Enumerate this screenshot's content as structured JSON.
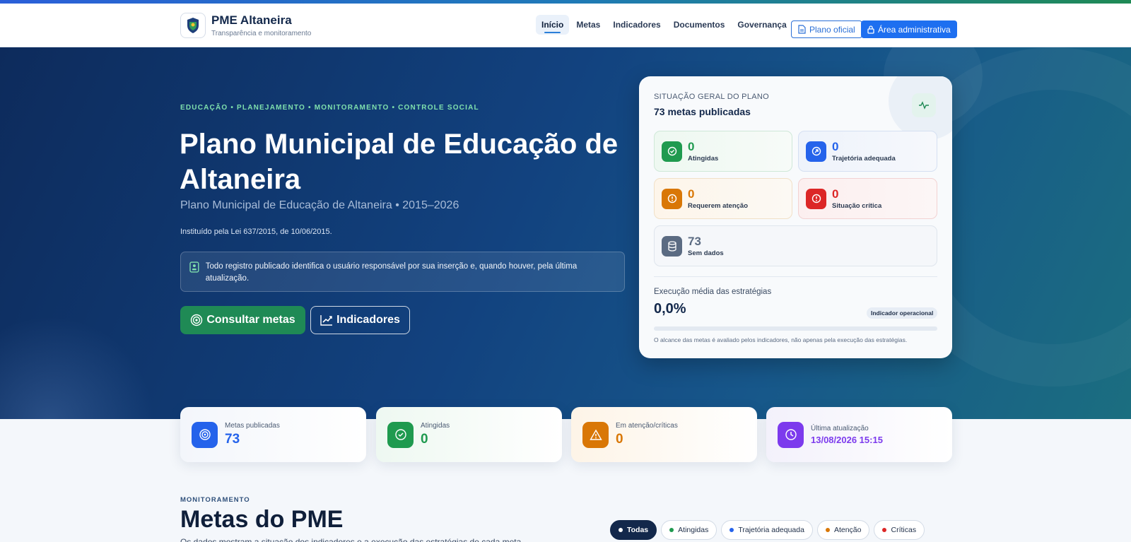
{
  "header": {
    "brand_name": "PME Altaneira",
    "brand_sub": "Transparência e monitoramento",
    "nav": [
      "Início",
      "Metas",
      "Indicadores",
      "Documentos",
      "Governança"
    ],
    "plan_button": "Plano oficial",
    "admin_button": "Área administrativa"
  },
  "hero": {
    "eyebrow": "EDUCAÇÃO • PLANEJAMENTO • MONITORAMENTO • CONTROLE SOCIAL",
    "title": "Plano Municipal de Educação de Altaneira",
    "subtitle": "Plano Municipal de Educação de Altaneira • 2015–2026",
    "law": "Instituído pela Lei 637/2015, de 10/06/2015.",
    "notice": "Todo registro publicado identifica o usuário responsável por sua inserção e, quando houver, pela última atualização.",
    "cta_metas": "Consultar metas",
    "cta_indicadores": "Indicadores"
  },
  "status_card": {
    "label": "SITUAÇÃO GERAL DO PLANO",
    "count": "73 metas publicadas",
    "tiles": [
      {
        "value": "0",
        "label": "Atingidas",
        "color": "#1f9a4f"
      },
      {
        "value": "0",
        "label": "Trajetória adequada",
        "color": "#2563eb"
      },
      {
        "value": "0",
        "label": "Requerem atenção",
        "color": "#d97706"
      },
      {
        "value": "0",
        "label": "Situação crítica",
        "color": "#dc2626"
      },
      {
        "value": "73",
        "label": "Sem dados",
        "color": "#5b6b82"
      }
    ],
    "exec_label": "Execução média das estratégias",
    "exec_value": "0,0%",
    "exec_fraction": 0,
    "exec_badge": "Indicador operacional",
    "exec_note": "O alcance das metas é avaliado pelos indicadores, não apenas pela execução das estratégias."
  },
  "summary": [
    {
      "label": "Metas publicadas",
      "value": "73",
      "color": "#2563eb"
    },
    {
      "label": "Atingidas",
      "value": "0",
      "color": "#1f9a4f"
    },
    {
      "label": "Em atenção/críticas",
      "value": "0",
      "color": "#d97706"
    },
    {
      "label": "Última atualização",
      "value": "13/08/2026 15:15",
      "color": "#7c3aed"
    }
  ],
  "monitoring": {
    "eyebrow": "MONITORAMENTO",
    "title": "Metas do PME",
    "description": "Os dados mostram a situação dos indicadores e a execução das estratégias de cada meta.",
    "filters": [
      {
        "label": "Todas",
        "color": "#ffffff"
      },
      {
        "label": "Atingidas",
        "color": "#1f9a4f"
      },
      {
        "label": "Trajetória adequada",
        "color": "#2563eb"
      },
      {
        "label": "Atenção",
        "color": "#d97706"
      },
      {
        "label": "Críticas",
        "color": "#dc2626"
      }
    ]
  }
}
